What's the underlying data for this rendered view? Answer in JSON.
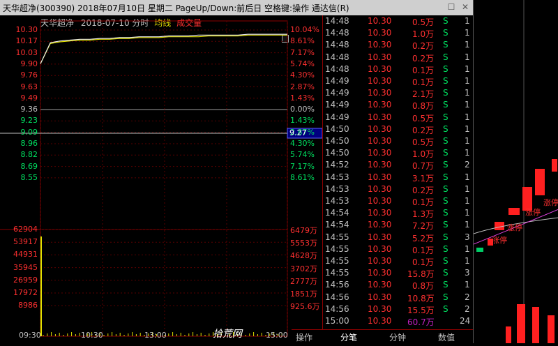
{
  "title": "天华超净(300390)  2018年07月10日  星期二  PageUp/Down:前后日  空格键:操作  通达信(R)",
  "window_controls": {
    "restore": "☐",
    "close": "✕"
  },
  "chart": {
    "stock_name": "天华超净",
    "date": "2018-07-10 分时",
    "avg_label": "均线",
    "vol_label": "成交量",
    "price_labels": [
      "10.30",
      "10.17",
      "10.03",
      "9.90",
      "9.76",
      "9.63",
      "9.49",
      "9.36",
      "9.23",
      "9.09",
      "8.96",
      "8.82",
      "8.69",
      "8.55"
    ],
    "pct_labels": [
      "10.04%",
      "8.61%",
      "7.17%",
      "5.74%",
      "4.30%",
      "2.87%",
      "1.43%",
      "0.00%",
      "1.43%",
      "2.87%",
      "4.30%",
      "5.74%",
      "7.17%",
      "8.61%"
    ],
    "vol_left_labels": [
      "62904",
      "53917",
      "44931",
      "35945",
      "26959",
      "17972",
      "8986"
    ],
    "vol_right_labels": [
      "6479万",
      "5553万",
      "4628万",
      "3702万",
      "2777万",
      "1851万",
      "925.6万"
    ],
    "time_labels": [
      "09:30",
      "10:30",
      "13:00",
      "15:00"
    ],
    "cursor_price": "9.27",
    "watermark": "拾荒网",
    "prev_close": 9.36,
    "price_series": [
      9.9,
      10.15,
      10.17,
      10.18,
      10.19,
      10.19,
      10.2,
      10.2,
      10.21,
      10.21,
      10.22,
      10.22,
      10.22,
      10.23,
      10.23,
      10.23,
      10.24,
      10.24,
      10.24,
      10.24,
      10.24,
      10.25,
      10.25,
      10.25,
      10.25,
      10.25
    ],
    "avg_series": [
      9.9,
      10.14,
      10.16,
      10.17,
      10.18,
      10.18,
      10.19,
      10.19,
      10.2,
      10.2,
      10.21,
      10.21,
      10.21,
      10.22,
      10.22,
      10.22,
      10.22,
      10.23,
      10.23,
      10.23,
      10.23,
      10.24,
      10.24,
      10.24,
      10.24,
      10.24
    ]
  },
  "trades": [
    {
      "time": "14:48",
      "price": "10.30",
      "vol": "0.5万",
      "side": "S",
      "n": "1"
    },
    {
      "time": "14:48",
      "price": "10.30",
      "vol": "1.0万",
      "side": "S",
      "n": "1"
    },
    {
      "time": "14:48",
      "price": "10.30",
      "vol": "0.2万",
      "side": "S",
      "n": "1"
    },
    {
      "time": "14:48",
      "price": "10.30",
      "vol": "0.2万",
      "side": "S",
      "n": "1"
    },
    {
      "time": "14:48",
      "price": "10.30",
      "vol": "0.1万",
      "side": "S",
      "n": "1"
    },
    {
      "time": "14:49",
      "price": "10.30",
      "vol": "0.1万",
      "side": "S",
      "n": "1"
    },
    {
      "time": "14:49",
      "price": "10.30",
      "vol": "2.1万",
      "side": "S",
      "n": "1"
    },
    {
      "time": "14:49",
      "price": "10.30",
      "vol": "0.8万",
      "side": "S",
      "n": "1"
    },
    {
      "time": "14:49",
      "price": "10.30",
      "vol": "0.5万",
      "side": "S",
      "n": "1"
    },
    {
      "time": "14:50",
      "price": "10.30",
      "vol": "0.2万",
      "side": "S",
      "n": "1"
    },
    {
      "time": "14:50",
      "price": "10.30",
      "vol": "0.5万",
      "side": "S",
      "n": "1"
    },
    {
      "time": "14:50",
      "price": "10.30",
      "vol": "1.0万",
      "side": "S",
      "n": "1"
    },
    {
      "time": "14:52",
      "price": "10.30",
      "vol": "0.7万",
      "side": "S",
      "n": "2"
    },
    {
      "time": "14:53",
      "price": "10.30",
      "vol": "3.1万",
      "side": "S",
      "n": "1"
    },
    {
      "time": "14:53",
      "price": "10.30",
      "vol": "0.2万",
      "side": "S",
      "n": "1"
    },
    {
      "time": "14:53",
      "price": "10.30",
      "vol": "0.1万",
      "side": "S",
      "n": "1"
    },
    {
      "time": "14:54",
      "price": "10.30",
      "vol": "1.3万",
      "side": "S",
      "n": "1"
    },
    {
      "time": "14:54",
      "price": "10.30",
      "vol": "7.2万",
      "side": "S",
      "n": "1"
    },
    {
      "time": "14:55",
      "price": "10.30",
      "vol": "5.2万",
      "side": "S",
      "n": "3"
    },
    {
      "time": "14:55",
      "price": "10.30",
      "vol": "0.1万",
      "side": "S",
      "n": "1"
    },
    {
      "time": "14:55",
      "price": "10.30",
      "vol": "0.1万",
      "side": "S",
      "n": "1"
    },
    {
      "time": "14:55",
      "price": "10.30",
      "vol": "15.8万",
      "side": "S",
      "n": "3"
    },
    {
      "time": "14:56",
      "price": "10.30",
      "vol": "0.8万",
      "side": "S",
      "n": "1"
    },
    {
      "time": "14:56",
      "price": "10.30",
      "vol": "10.8万",
      "side": "S",
      "n": "2"
    },
    {
      "time": "14:56",
      "price": "10.30",
      "vol": "15.5万",
      "side": "S",
      "n": "2"
    },
    {
      "time": "15:00",
      "price": "10.30",
      "vol": "60.7万",
      "side": "",
      "n": "24"
    }
  ],
  "tabs": [
    "操作",
    "分笔",
    "分钟",
    "数值"
  ],
  "right_panel": {
    "labels": [
      "涨停",
      "涨停",
      "涨停",
      "涨停"
    ]
  }
}
